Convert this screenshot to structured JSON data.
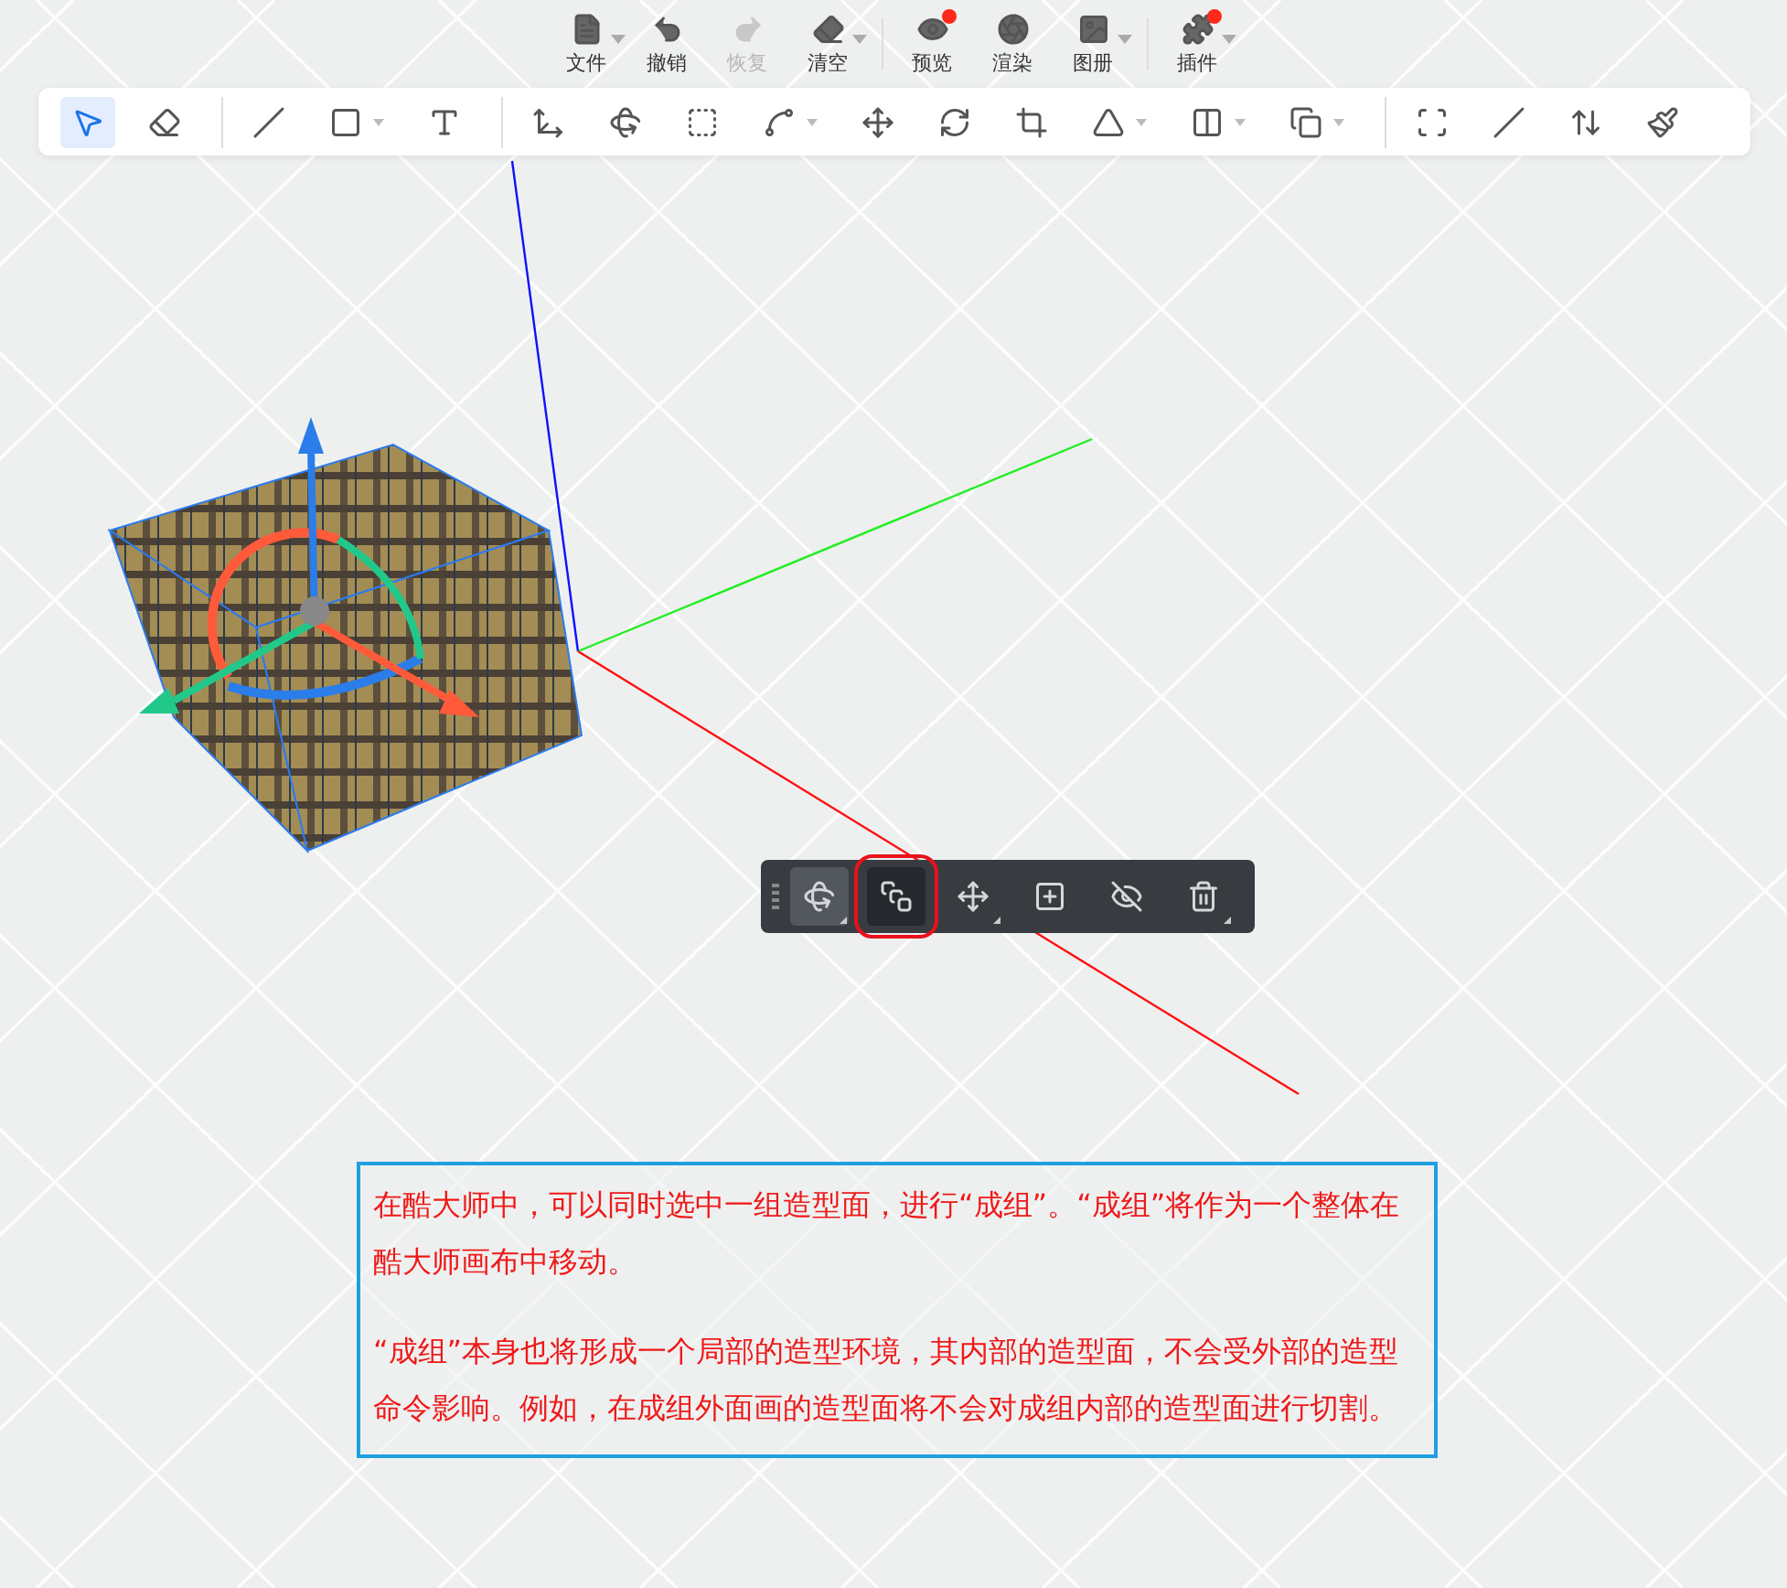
{
  "menu": [
    {
      "label": "文件",
      "dropdown": true,
      "disabled": false,
      "badge": false
    },
    {
      "label": "撤销",
      "dropdown": false,
      "disabled": false,
      "badge": false
    },
    {
      "label": "恢复",
      "dropdown": false,
      "disabled": true,
      "badge": false
    },
    {
      "label": "清空",
      "dropdown": true,
      "disabled": false,
      "badge": false
    },
    {
      "label": "预览",
      "dropdown": false,
      "disabled": false,
      "badge": true
    },
    {
      "label": "渲染",
      "dropdown": false,
      "disabled": false,
      "badge": false
    },
    {
      "label": "图册",
      "dropdown": true,
      "disabled": false,
      "badge": false
    },
    {
      "label": "插件",
      "dropdown": true,
      "disabled": false,
      "badge": true
    }
  ],
  "tool_groups": [
    [
      {
        "selected": true,
        "dropdown": false
      },
      {
        "selected": false,
        "dropdown": false
      }
    ],
    [
      {
        "selected": false,
        "dropdown": false
      },
      {
        "selected": false,
        "dropdown": true
      },
      {
        "selected": false,
        "dropdown": false
      }
    ],
    [
      {
        "selected": false,
        "dropdown": false
      },
      {
        "selected": false,
        "dropdown": false
      },
      {
        "selected": false,
        "dropdown": false
      },
      {
        "selected": false,
        "dropdown": true
      },
      {
        "selected": false,
        "dropdown": false
      },
      {
        "selected": false,
        "dropdown": false
      },
      {
        "selected": false,
        "dropdown": false
      },
      {
        "selected": false,
        "dropdown": true
      },
      {
        "selected": false,
        "dropdown": true
      },
      {
        "selected": false,
        "dropdown": true
      }
    ],
    [
      {
        "selected": false,
        "dropdown": false
      },
      {
        "selected": false,
        "dropdown": false
      },
      {
        "selected": false,
        "dropdown": false
      },
      {
        "selected": false,
        "dropdown": false
      }
    ]
  ],
  "selection_toolbar": [
    {
      "selected": true,
      "outlined": false,
      "dropdown": true
    },
    {
      "selected": false,
      "outlined": true,
      "dropdown": false
    },
    {
      "selected": false,
      "outlined": false,
      "dropdown": true
    },
    {
      "selected": false,
      "outlined": false,
      "dropdown": false
    },
    {
      "selected": false,
      "outlined": false,
      "dropdown": false
    },
    {
      "selected": false,
      "outlined": false,
      "dropdown": true
    }
  ],
  "note": {
    "paragraphs": [
      "在酷大师中，可以同时选中一组造型面，进行“成组”。“成组”将作为一个整体在酷大师画布中移动。",
      "“成组”本身也将形成一个局部的造型环境，其内部的造型面，不会受外部的造型命令影响。例如，在成组外面画的造型面将不会对成组内部的造型面进行切割。"
    ]
  }
}
